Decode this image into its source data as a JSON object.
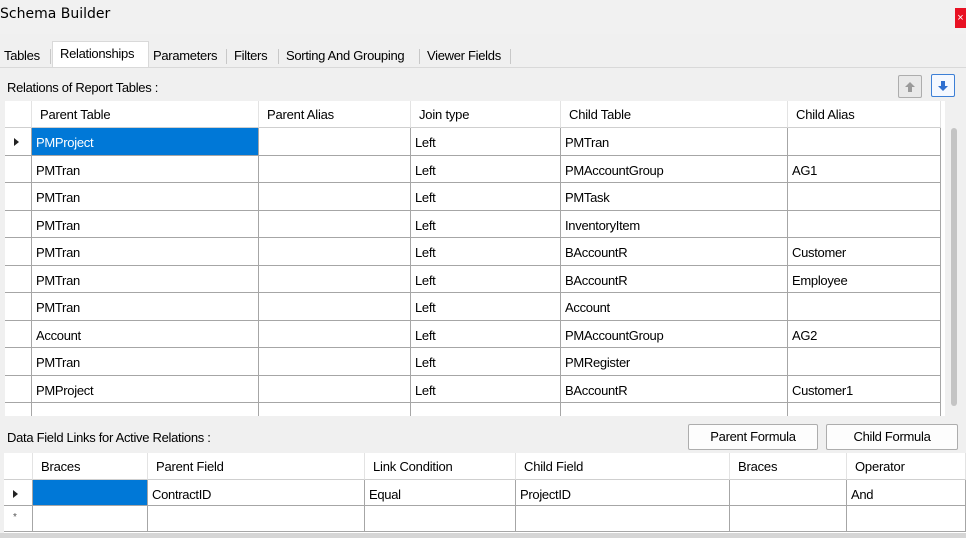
{
  "window": {
    "title": "Schema Builder",
    "close_label": "×"
  },
  "tabs": [
    {
      "label": "Tables",
      "active": false
    },
    {
      "label": "Relationships",
      "active": true
    },
    {
      "label": "Parameters",
      "active": false
    },
    {
      "label": "Filters",
      "active": false
    },
    {
      "label": "Sorting And Grouping",
      "active": false
    },
    {
      "label": "Viewer Fields",
      "active": false
    }
  ],
  "relations": {
    "label": "Relations of Report Tables :",
    "columns": [
      "Parent Table",
      "Parent Alias",
      "Join type",
      "Child Table",
      "Child Alias"
    ],
    "rows": [
      [
        "PMProject",
        "",
        "Left",
        "PMTran",
        ""
      ],
      [
        "PMTran",
        "",
        "Left",
        "PMAccountGroup",
        "AG1"
      ],
      [
        "PMTran",
        "",
        "Left",
        "PMTask",
        ""
      ],
      [
        "PMTran",
        "",
        "Left",
        "InventoryItem",
        ""
      ],
      [
        "PMTran",
        "",
        "Left",
        "BAccountR",
        "Customer"
      ],
      [
        "PMTran",
        "",
        "Left",
        "BAccountR",
        "Employee"
      ],
      [
        "PMTran",
        "",
        "Left",
        "Account",
        ""
      ],
      [
        "Account",
        "",
        "Left",
        "PMAccountGroup",
        "AG2"
      ],
      [
        "PMTran",
        "",
        "Left",
        "PMRegister",
        ""
      ],
      [
        "PMProject",
        "",
        "Left",
        "BAccountR",
        "Customer1"
      ],
      [
        "",
        "",
        "",
        "",
        ""
      ]
    ],
    "selected_row": 0,
    "move_up_icon": "arrow-up-icon",
    "move_down_icon": "arrow-down-icon"
  },
  "links": {
    "label": "Data Field Links for Active Relations :",
    "parent_formula_label": "Parent Formula",
    "child_formula_label": "Child Formula",
    "columns": [
      "Braces",
      "Parent Field",
      "Link Condition",
      "Child Field",
      "Braces",
      "Operator"
    ],
    "rows": [
      [
        "",
        "ContractID",
        "Equal",
        "ProjectID",
        "",
        "And"
      ],
      [
        "",
        "",
        "",
        "",
        "",
        ""
      ]
    ],
    "new_row_marker": "*"
  },
  "colors": {
    "selection": "#0078d7",
    "accent_blue": "#3c7fd6",
    "close": "#e81123"
  }
}
